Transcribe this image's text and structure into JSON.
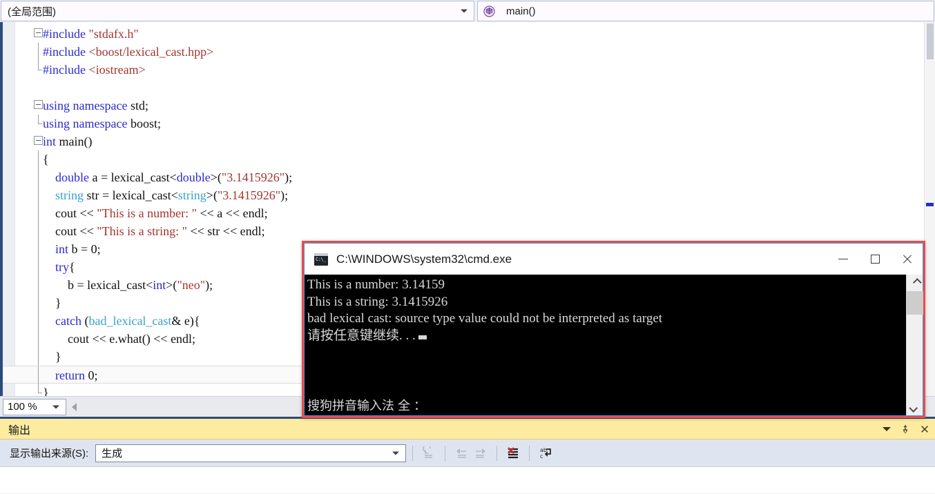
{
  "navbar": {
    "scope_value": "(全局范围)",
    "member_value": "main()",
    "scope_icon": "chevron-down-icon",
    "member_icon": "method-cube-icon"
  },
  "editor": {
    "zoom_level": "100 %",
    "lines": [
      {
        "indent": 0,
        "fold": "box",
        "segments": [
          {
            "t": "#include ",
            "c": "pp"
          },
          {
            "t": "\"stdafx.h\"",
            "c": "str"
          }
        ]
      },
      {
        "indent": 0,
        "fold": "line",
        "segments": [
          {
            "t": "#include ",
            "c": "pp"
          },
          {
            "t": "<boost/lexical_cast.hpp>",
            "c": "str"
          }
        ]
      },
      {
        "indent": 0,
        "fold": "end",
        "segments": [
          {
            "t": "#include ",
            "c": "pp"
          },
          {
            "t": "<iostream>",
            "c": "str"
          }
        ]
      },
      {
        "indent": 0,
        "fold": "none",
        "segments": []
      },
      {
        "indent": 0,
        "fold": "box",
        "segments": [
          {
            "t": "using",
            "c": "kw"
          },
          {
            "t": " ",
            "c": "plain"
          },
          {
            "t": "namespace",
            "c": "kw"
          },
          {
            "t": " std;",
            "c": "plain"
          }
        ]
      },
      {
        "indent": 0,
        "fold": "end",
        "segments": [
          {
            "t": "using",
            "c": "kw"
          },
          {
            "t": " ",
            "c": "plain"
          },
          {
            "t": "namespace",
            "c": "kw"
          },
          {
            "t": " boost;",
            "c": "plain"
          }
        ]
      },
      {
        "indent": 0,
        "fold": "box",
        "segments": [
          {
            "t": "int",
            "c": "kw"
          },
          {
            "t": " main()",
            "c": "plain"
          }
        ]
      },
      {
        "indent": 0,
        "fold": "line",
        "segments": [
          {
            "t": "{",
            "c": "plain"
          }
        ]
      },
      {
        "indent": 0,
        "fold": "line",
        "segments": [
          {
            "t": "    ",
            "c": "plain"
          },
          {
            "t": "double",
            "c": "kw"
          },
          {
            "t": " a = lexical_cast<",
            "c": "plain"
          },
          {
            "t": "double",
            "c": "kw"
          },
          {
            "t": ">(",
            "c": "plain"
          },
          {
            "t": "\"3.1415926\"",
            "c": "str"
          },
          {
            "t": ");",
            "c": "plain"
          }
        ]
      },
      {
        "indent": 0,
        "fold": "line",
        "segments": [
          {
            "t": "    ",
            "c": "plain"
          },
          {
            "t": "string",
            "c": "type"
          },
          {
            "t": " str = lexical_cast<",
            "c": "plain"
          },
          {
            "t": "string",
            "c": "type"
          },
          {
            "t": ">(",
            "c": "plain"
          },
          {
            "t": "\"3.1415926\"",
            "c": "str"
          },
          {
            "t": ");",
            "c": "plain"
          }
        ]
      },
      {
        "indent": 0,
        "fold": "line",
        "segments": [
          {
            "t": "    cout << ",
            "c": "plain"
          },
          {
            "t": "\"This is a number: \"",
            "c": "str"
          },
          {
            "t": " << a << endl;",
            "c": "plain"
          }
        ]
      },
      {
        "indent": 0,
        "fold": "line",
        "segments": [
          {
            "t": "    cout << ",
            "c": "plain"
          },
          {
            "t": "\"This is a string: \"",
            "c": "str"
          },
          {
            "t": " << str << endl;",
            "c": "plain"
          }
        ]
      },
      {
        "indent": 0,
        "fold": "line",
        "segments": [
          {
            "t": "    ",
            "c": "plain"
          },
          {
            "t": "int",
            "c": "kw"
          },
          {
            "t": " b = 0;",
            "c": "plain"
          }
        ]
      },
      {
        "indent": 0,
        "fold": "line",
        "segments": [
          {
            "t": "    ",
            "c": "plain"
          },
          {
            "t": "try",
            "c": "kw"
          },
          {
            "t": "{",
            "c": "plain"
          }
        ]
      },
      {
        "indent": 0,
        "fold": "line",
        "segments": [
          {
            "t": "        b = lexical_cast<",
            "c": "plain"
          },
          {
            "t": "int",
            "c": "kw"
          },
          {
            "t": ">(",
            "c": "plain"
          },
          {
            "t": "\"neo\"",
            "c": "str"
          },
          {
            "t": ");",
            "c": "plain"
          }
        ]
      },
      {
        "indent": 0,
        "fold": "line",
        "segments": [
          {
            "t": "    }",
            "c": "plain"
          }
        ]
      },
      {
        "indent": 0,
        "fold": "line",
        "segments": [
          {
            "t": "    ",
            "c": "plain"
          },
          {
            "t": "catch",
            "c": "kw"
          },
          {
            "t": " (",
            "c": "plain"
          },
          {
            "t": "bad_lexical_cast",
            "c": "cls"
          },
          {
            "t": "& e){",
            "c": "plain"
          }
        ]
      },
      {
        "indent": 0,
        "fold": "line",
        "segments": [
          {
            "t": "        cout << e.what() << endl;",
            "c": "plain"
          }
        ]
      },
      {
        "indent": 0,
        "fold": "line",
        "segments": [
          {
            "t": "    }",
            "c": "plain"
          }
        ]
      },
      {
        "indent": 0,
        "fold": "line",
        "current": true,
        "segments": [
          {
            "t": "    ",
            "c": "plain"
          },
          {
            "t": "return",
            "c": "kw"
          },
          {
            "t": " 0;",
            "c": "plain"
          }
        ]
      },
      {
        "indent": 0,
        "fold": "end",
        "segments": [
          {
            "t": "}",
            "c": "plain"
          }
        ]
      }
    ]
  },
  "console": {
    "title": "C:\\WINDOWS\\system32\\cmd.exe",
    "icon": "cmd-console-icon",
    "minimize_label": "—",
    "maximize_label": "▢",
    "close_label": "✕",
    "lines": [
      "This is a number: 3.14159",
      "This is a string: 3.1415926",
      "bad lexical cast: source type value could not be interpreted as target",
      "请按任意键继续. . ."
    ],
    "ime_status": "搜狗拼音输入法 全 ：",
    "border_color": "#ea4b4b"
  },
  "output": {
    "title": "输出",
    "source_label": "显示输出来源(S):",
    "source_value": "生成",
    "header_icons": [
      "chevron-down-icon",
      "pin-icon",
      "close-icon"
    ],
    "toolbar_icons": [
      "find-message-in-code-icon",
      "go-to-previous-message-icon",
      "go-to-next-message-icon",
      "clear-all-icon",
      "toggle-word-wrap-icon"
    ]
  }
}
